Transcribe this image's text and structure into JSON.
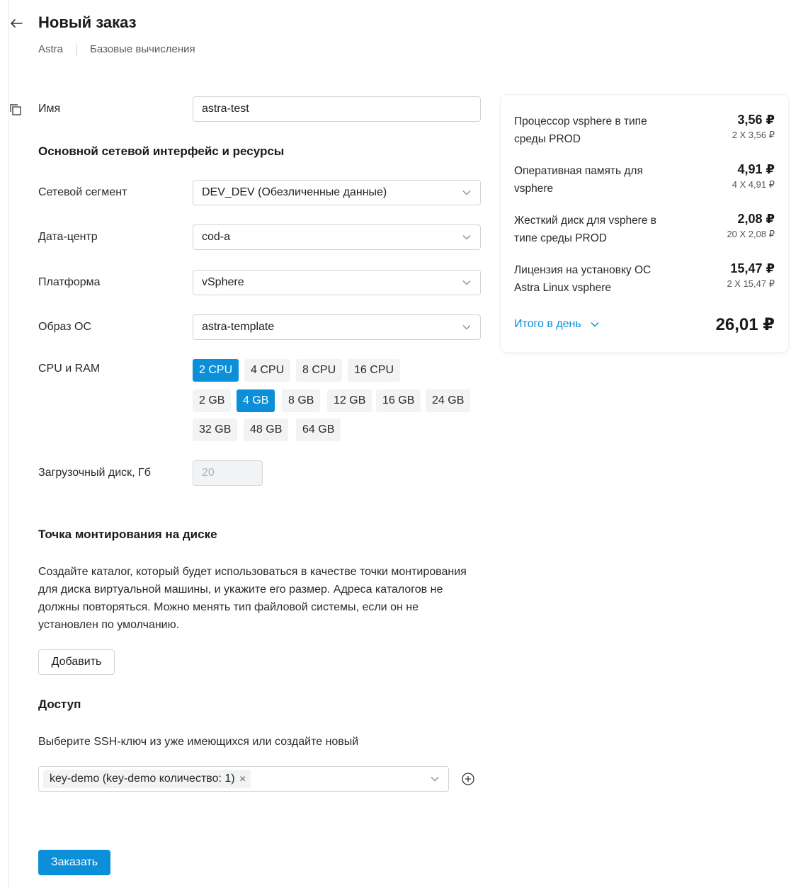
{
  "header": {
    "title": "Новый заказ",
    "breadcrumb": [
      "Astra",
      "Базовые вычисления"
    ]
  },
  "form": {
    "name_label": "Имя",
    "name_value": "astra-test",
    "network_section_title": "Основной сетевой интерфейс и ресурсы",
    "segment_label": "Сетевой сегмент",
    "segment_value": "DEV_DEV (Обезличенные данные)",
    "datacenter_label": "Дата-центр",
    "datacenter_value": "cod-a",
    "platform_label": "Платформа",
    "platform_value": "vSphere",
    "os_label": "Образ ОС",
    "os_value": "astra-template",
    "cpu_ram_label": "CPU и RAM",
    "cpu_options": [
      "2 CPU",
      "4 CPU",
      "8 CPU",
      "16 CPU"
    ],
    "cpu_selected": "2 CPU",
    "ram_options": [
      "2 GB",
      "4 GB",
      "8 GB",
      "12 GB",
      "16 GB",
      "24 GB",
      "32 GB",
      "48 GB",
      "64 GB"
    ],
    "ram_selected": "4 GB",
    "boot_disk_label": "Загрузочный диск, Гб",
    "boot_disk_value": "20",
    "mount_section_title": "Точка монтирования на диске",
    "mount_description": "Создайте каталог, который будет использоваться в качестве точки монтирования для диска виртуальной машины, и укажите его размер. Адреса каталогов не должны повторяться. Можно менять тип файловой системы, если он не установлен по умолчанию.",
    "add_button": "Добавить",
    "access_section_title": "Доступ",
    "ssh_hint": "Выберите SSH-ключ из уже имеющихся или создайте новый",
    "ssh_selected_tag": "key-demo (key-demo количество: 1)",
    "submit_button": "Заказать"
  },
  "pricing": {
    "items": [
      {
        "name": "Процессор vsphere в типе среды PROD",
        "price": "3,56 ₽",
        "detail": "2 X 3,56 ₽"
      },
      {
        "name": "Оперативная память для vsphere",
        "price": "4,91 ₽",
        "detail": "4 X 4,91 ₽"
      },
      {
        "name": "Жесткий диск для vsphere в типе среды PROD",
        "price": "2,08 ₽",
        "detail": "20 X 2,08 ₽"
      },
      {
        "name": "Лицензия на установку ОС Astra Linux vsphere",
        "price": "15,47 ₽",
        "detail": "2 X 15,47 ₽"
      }
    ],
    "total_label": "Итого в день",
    "total_value": "26,01 ₽"
  },
  "colors": {
    "accent": "#0a8fd8",
    "chip_bg": "#f1f3f4"
  },
  "icons": [
    "arrow-left-icon",
    "copy-icon",
    "chevron-down-icon",
    "close-icon",
    "plus-circle-icon"
  ]
}
